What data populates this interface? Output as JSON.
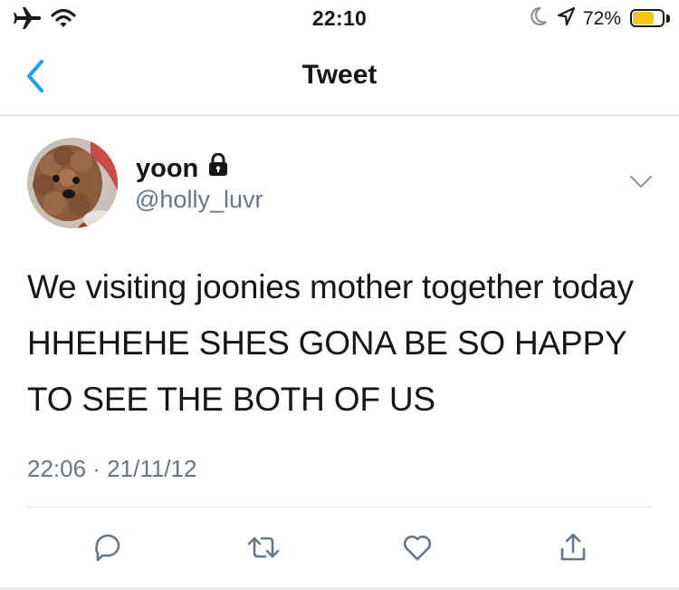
{
  "status_bar": {
    "time": "22:10",
    "battery_percent_label": "72%",
    "battery_level": 0.72,
    "icons": [
      "airplane-icon",
      "wifi-icon",
      "moon-icon",
      "location-arrow-icon",
      "battery-icon"
    ]
  },
  "nav": {
    "title": "Tweet",
    "back_icon": "chevron-left-icon"
  },
  "tweet": {
    "display_name": "yoon",
    "handle": "@holly_luvr",
    "protected_icon": "lock-icon",
    "text": "We visiting joonies mother together today HHEHEHE SHES GONA BE SO HAPPY TO SEE THE BOTH OF US",
    "timestamp": "22:06 · 21/11/12",
    "more_icon": "chevron-down-icon"
  },
  "actions": [
    {
      "name": "reply",
      "icon": "reply-icon"
    },
    {
      "name": "retweet",
      "icon": "retweet-icon"
    },
    {
      "name": "like",
      "icon": "heart-icon"
    },
    {
      "name": "share",
      "icon": "share-icon"
    }
  ],
  "colors": {
    "accent": "#1da1f2",
    "text_primary": "#14171a",
    "text_secondary": "#657786",
    "battery_fill": "#f5c518",
    "divider": "#cfd5da"
  }
}
